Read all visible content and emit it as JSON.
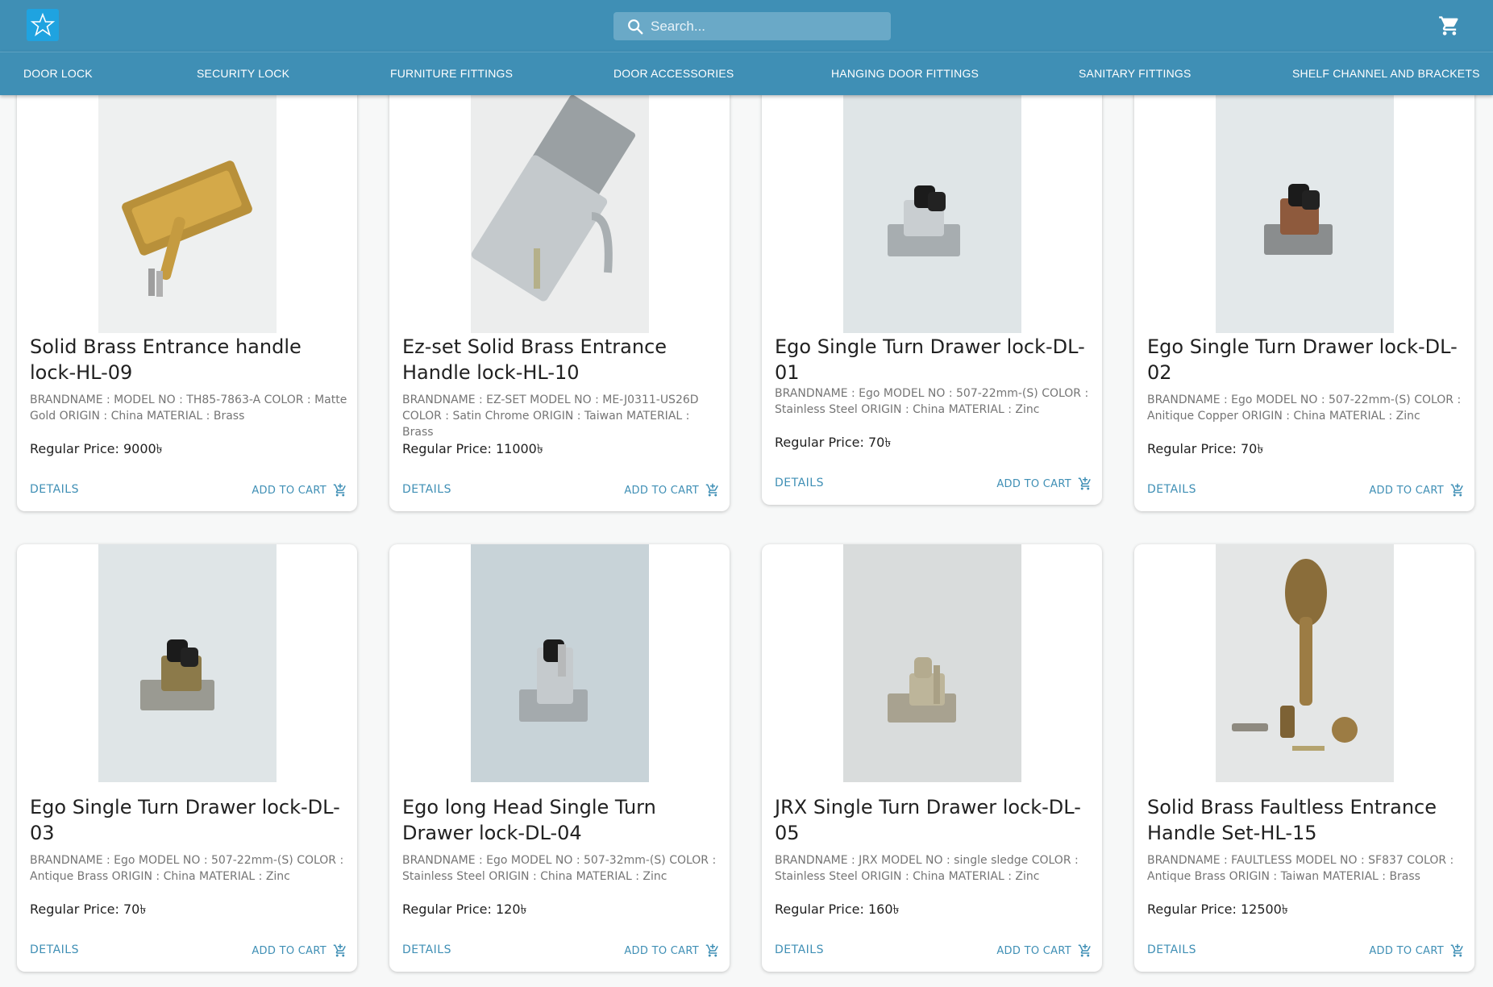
{
  "header": {
    "search_placeholder": "Search...",
    "logo_icon": "star-logo",
    "cart_icon": "shopping-cart-icon",
    "accent": "#3f8fb5"
  },
  "nav": {
    "items": [
      {
        "label": "DOOR LOCK"
      },
      {
        "label": "SECURITY LOCK"
      },
      {
        "label": "FURNITURE FITTINGS"
      },
      {
        "label": "DOOR ACCESSORIES"
      },
      {
        "label": "HANGING DOOR FITTINGS"
      },
      {
        "label": "SANITARY FITTINGS"
      },
      {
        "label": "SHELF CHANNEL AND BRACKETS"
      }
    ]
  },
  "products": [
    {
      "title": "Solid Brass Entrance handle lock-HL-09",
      "desc": "BRANDNAME : MODEL NO : TH85-7863-A COLOR : Matte Gold ORIGIN : China MATERIAL : Brass",
      "price": "Regular Price: 9000৳",
      "details": "DETAILS",
      "add_to_cart": "ADD TO CART"
    },
    {
      "title": "Ez-set Solid Brass Entrance Handle lock-HL-10",
      "desc": "BRANDNAME : EZ-SET MODEL NO : ME-J0311-US26D COLOR : Satin Chrome ORIGIN : Taiwan MATERIAL : Brass",
      "price": "Regular Price: 11000৳",
      "details": "DETAILS",
      "add_to_cart": "ADD TO CART"
    },
    {
      "title": "Ego Single Turn Drawer lock-DL-01",
      "desc": "BRANDNAME : Ego MODEL NO : 507-22mm-(S) COLOR : Stainless Steel ORIGIN : China MATERIAL : Zinc",
      "price": "Regular Price: 70৳",
      "details": "DETAILS",
      "add_to_cart": "ADD TO CART"
    },
    {
      "title": "Ego Single Turn Drawer lock-DL-02",
      "desc": "BRANDNAME : Ego MODEL NO : 507-22mm-(S) COLOR : Anitique Copper ORIGIN : China MATERIAL : Zinc",
      "price": "Regular Price: 70৳",
      "details": "DETAILS",
      "add_to_cart": "ADD TO CART"
    },
    {
      "title": "Ego Single Turn Drawer lock-DL-03",
      "desc": "BRANDNAME : Ego MODEL NO : 507-22mm-(S) COLOR : Antique Brass ORIGIN : China MATERIAL : Zinc",
      "price": "Regular Price: 70৳",
      "details": "DETAILS",
      "add_to_cart": "ADD TO CART"
    },
    {
      "title": "Ego long Head Single Turn Drawer lock-DL-04",
      "desc": "BRANDNAME : Ego MODEL NO : 507-32mm-(S) COLOR : Stainless Steel ORIGIN : China MATERIAL : Zinc",
      "price": "Regular Price: 120৳",
      "details": "DETAILS",
      "add_to_cart": "ADD TO CART"
    },
    {
      "title": "JRX Single Turn Drawer lock-DL-05",
      "desc": "BRANDNAME : JRX MODEL NO : single sledge COLOR : Stainless Steel ORIGIN : China MATERIAL : Zinc",
      "price": "Regular Price: 160৳",
      "details": "DETAILS",
      "add_to_cart": "ADD TO CART"
    },
    {
      "title": "Solid Brass Faultless Entrance Handle Set-HL-15",
      "desc": "BRANDNAME : FAULTLESS MODEL NO : SF837 COLOR : Antique Brass ORIGIN : Taiwan MATERIAL : Brass",
      "price": "Regular Price: 12500৳",
      "details": "DETAILS",
      "add_to_cart": "ADD TO CART"
    }
  ]
}
